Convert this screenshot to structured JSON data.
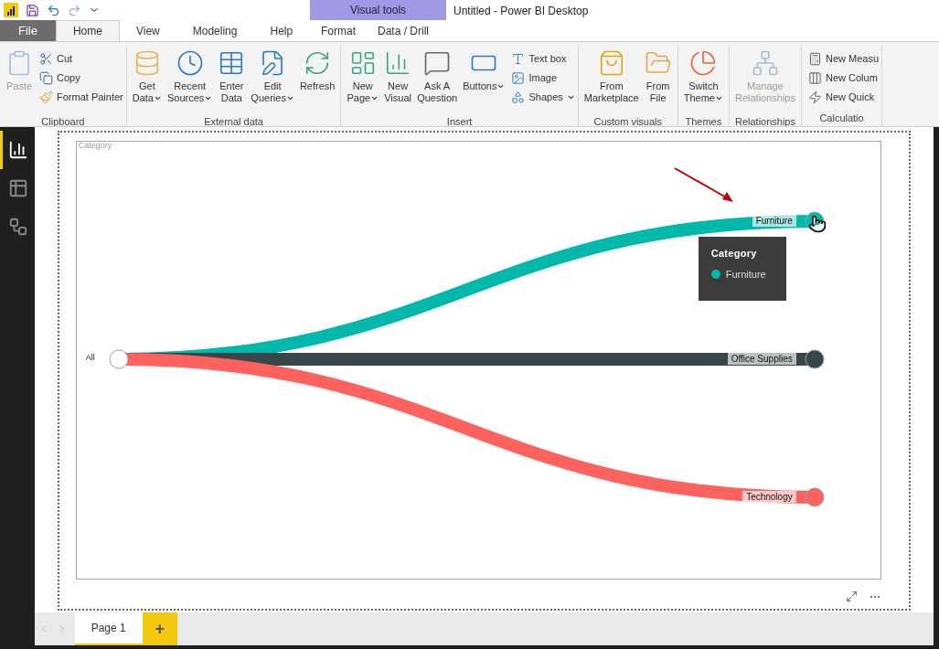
{
  "window": {
    "title": "Untitled - Power BI Desktop"
  },
  "contextual_tab_group": {
    "label": "Visual tools"
  },
  "tabs": [
    {
      "label": "File",
      "selected": false,
      "kind": "file"
    },
    {
      "label": "Home",
      "selected": true,
      "kind": "tab"
    },
    {
      "label": "View",
      "selected": false,
      "kind": "tab"
    },
    {
      "label": "Modeling",
      "selected": false,
      "kind": "tab"
    },
    {
      "label": "Help",
      "selected": false,
      "kind": "tab"
    },
    {
      "label": "Format",
      "selected": false,
      "kind": "contextual"
    },
    {
      "label": "Data / Drill",
      "selected": false,
      "kind": "contextual"
    }
  ],
  "ribbon_groups": [
    {
      "label": "Clipboard",
      "items": [
        {
          "kind": "large",
          "lines": [
            "Paste"
          ],
          "dropdown": false,
          "disabled": true
        },
        {
          "kind": "small",
          "lines": [
            "Cut"
          ],
          "dropdown": false,
          "disabled": false
        },
        {
          "kind": "small",
          "lines": [
            "Copy"
          ],
          "dropdown": false,
          "disabled": false
        },
        {
          "kind": "small",
          "lines": [
            "Format Painter"
          ],
          "dropdown": false,
          "disabled": false
        }
      ]
    },
    {
      "label": "External data",
      "items": [
        {
          "kind": "large",
          "lines": [
            "Get",
            "Data"
          ],
          "dropdown": true,
          "disabled": false
        },
        {
          "kind": "large",
          "lines": [
            "Recent",
            "Sources"
          ],
          "dropdown": true,
          "disabled": false
        },
        {
          "kind": "large",
          "lines": [
            "Enter",
            "Data"
          ],
          "dropdown": false,
          "disabled": false
        },
        {
          "kind": "large",
          "lines": [
            "Edit",
            "Queries"
          ],
          "dropdown": true,
          "disabled": false
        },
        {
          "kind": "large",
          "lines": [
            "Refresh"
          ],
          "dropdown": false,
          "disabled": false
        }
      ]
    },
    {
      "label": "Insert",
      "items": [
        {
          "kind": "large",
          "lines": [
            "New",
            "Page"
          ],
          "dropdown": true,
          "disabled": false
        },
        {
          "kind": "large",
          "lines": [
            "New",
            "Visual"
          ],
          "dropdown": false,
          "disabled": false
        },
        {
          "kind": "large",
          "lines": [
            "Ask A",
            "Question"
          ],
          "dropdown": false,
          "disabled": false
        },
        {
          "kind": "large",
          "lines": [
            "Buttons"
          ],
          "dropdown": true,
          "disabled": false
        },
        {
          "kind": "small",
          "lines": [
            "Text box"
          ],
          "dropdown": false,
          "disabled": false
        },
        {
          "kind": "small",
          "lines": [
            "Image"
          ],
          "dropdown": false,
          "disabled": false
        },
        {
          "kind": "small",
          "lines": [
            "Shapes"
          ],
          "dropdown": true,
          "disabled": false
        }
      ]
    },
    {
      "label": "Custom visuals",
      "items": [
        {
          "kind": "large",
          "lines": [
            "From",
            "Marketplace"
          ],
          "dropdown": false,
          "disabled": false
        },
        {
          "kind": "large",
          "lines": [
            "From",
            "File"
          ],
          "dropdown": false,
          "disabled": false
        }
      ]
    },
    {
      "label": "Themes",
      "items": [
        {
          "kind": "large",
          "lines": [
            "Switch",
            "Theme"
          ],
          "dropdown": true,
          "disabled": false
        }
      ]
    },
    {
      "label": "Relationships",
      "items": [
        {
          "kind": "large",
          "lines": [
            "Manage",
            "Relationships"
          ],
          "dropdown": false,
          "disabled": true
        }
      ]
    },
    {
      "label": "Calculatio",
      "items": [
        {
          "kind": "small",
          "lines": [
            "New Measu"
          ],
          "dropdown": false,
          "disabled": false
        },
        {
          "kind": "small",
          "lines": [
            "New Colum"
          ],
          "dropdown": false,
          "disabled": false
        },
        {
          "kind": "small",
          "lines": [
            "New Quick"
          ],
          "dropdown": false,
          "disabled": false
        }
      ]
    }
  ],
  "sidebar": {
    "items": [
      {
        "kind": "report",
        "selected": true
      },
      {
        "kind": "data",
        "selected": false
      },
      {
        "kind": "model",
        "selected": false
      }
    ]
  },
  "visual": {
    "title": "Category",
    "source_node": {
      "label": "All"
    },
    "target_nodes": [
      {
        "label": "Furniture",
        "color": "#01b8aa"
      },
      {
        "label": "Office Supplies",
        "color": "#374649"
      },
      {
        "label": "Technology",
        "color": "#fd625e"
      }
    ],
    "tooltip": {
      "title": "Category",
      "item": {
        "label": "Furniture",
        "color": "#01b8aa"
      }
    }
  },
  "page_tabs": [
    {
      "label": "Page 1",
      "selected": true
    }
  ],
  "add_page": {
    "label": "+"
  }
}
